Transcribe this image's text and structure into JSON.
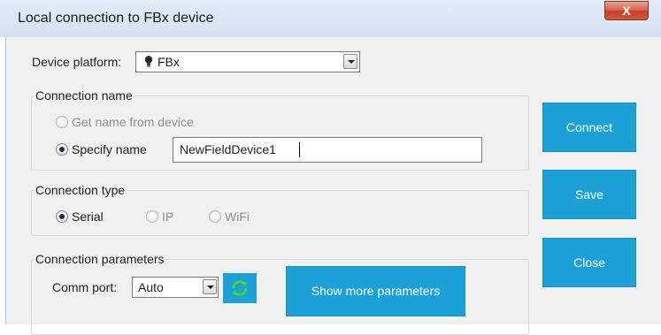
{
  "window": {
    "title": "Local connection to FBx device",
    "close_label": "X"
  },
  "device_platform": {
    "label": "Device platform:",
    "value": "FBx",
    "icon": "device-bulb-icon"
  },
  "connection_name": {
    "title": "Connection name",
    "options": [
      {
        "label": "Get name from device",
        "checked": false,
        "enabled": false
      },
      {
        "label": "Specify name",
        "checked": true,
        "enabled": true
      }
    ],
    "name_value": "NewFieldDevice1"
  },
  "connection_type": {
    "title": "Connection type",
    "options": [
      {
        "label": "Serial",
        "checked": true,
        "enabled": true
      },
      {
        "label": "IP",
        "checked": false,
        "enabled": false
      },
      {
        "label": "WiFi",
        "checked": false,
        "enabled": false
      }
    ]
  },
  "connection_parameters": {
    "title": "Connection parameters",
    "comm_port_label": "Comm port:",
    "comm_port_value": "Auto",
    "refresh_icon": "refresh-icon",
    "show_more_label": "Show more parameters"
  },
  "actions": {
    "connect_label": "Connect",
    "save_label": "Save",
    "close_label": "Close"
  },
  "colors": {
    "accent": "#1ba0d7",
    "refresh_green": "#4fd03b",
    "dialog_bg": "#f0f0f0",
    "titlebar": "#d8e5f3",
    "close_red": "#c9452d"
  }
}
